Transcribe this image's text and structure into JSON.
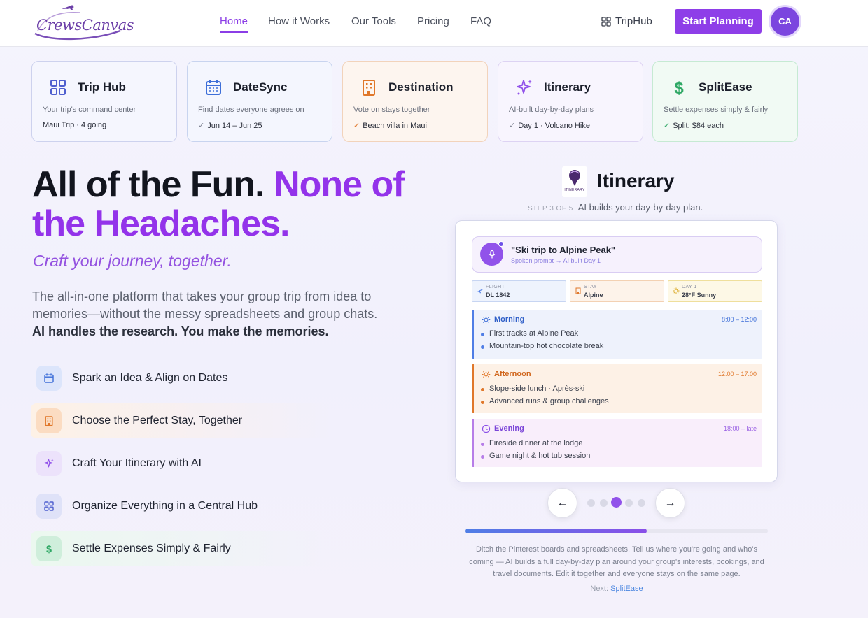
{
  "brand": {
    "name": "CrewsCanvas"
  },
  "nav": {
    "links": [
      "Home",
      "How it Works",
      "Our Tools",
      "Pricing",
      "FAQ"
    ],
    "triphub_label": "TripHub",
    "cta_label": "Start Planning",
    "avatar_initials": "CA"
  },
  "cards": [
    {
      "title": "Trip Hub",
      "subtitle": "Your trip's command center",
      "meta": "Maui Trip · 4 going",
      "icon": "grid-icon",
      "color": "#4f5fcf"
    },
    {
      "title": "DateSync",
      "subtitle": "Find dates everyone agrees on",
      "meta": "Jun 14 – Jun 25",
      "icon": "calendar-icon",
      "color": "#3e6fd8"
    },
    {
      "title": "Destination",
      "subtitle": "Vote on stays together",
      "meta": "Beach villa in Maui",
      "icon": "building-icon",
      "color": "#e0772a"
    },
    {
      "title": "Itinerary",
      "subtitle": "AI-built day-by-day plans",
      "meta": "Day 1 · Volcano Hike",
      "icon": "sparkle-icon",
      "color": "#9152ea"
    },
    {
      "title": "SplitEase",
      "subtitle": "Settle expenses simply & fairly",
      "meta": "Split: $84 each",
      "icon": "dollar-icon",
      "color": "#2fa865"
    }
  ],
  "hero": {
    "title_dark": "All of the Fun. ",
    "title_purple": "None of the Headaches.",
    "tagline": "Craft your journey, together.",
    "description": "The all-in-one platform that takes your group trip from idea to memories—without the messy spreadsheets and group chats.",
    "description_bold": "AI handles the research. You make the memories."
  },
  "steps": [
    {
      "label": "Spark an Idea & Align on Dates",
      "icon": "calendar-icon",
      "color": "#3e6fd8"
    },
    {
      "label": "Choose the Perfect Stay, Together",
      "icon": "building-icon",
      "color": "#e0772a"
    },
    {
      "label": "Craft Your Itinerary with AI",
      "icon": "sparkle-icon",
      "color": "#9152ea"
    },
    {
      "label": "Organize Everything in a Central Hub",
      "icon": "grid-icon",
      "color": "#4f5fcf"
    },
    {
      "label": "Settle Expenses Simply & Fairly",
      "icon": "dollar-icon",
      "color": "#2fa865"
    }
  ],
  "pane": {
    "title": "Itinerary",
    "step_count": "STEP 3 OF 5",
    "step_desc": "AI builds your day-by-day plan.",
    "logo_text": "ITINERARY"
  },
  "phone": {
    "prompt_text": "\"Ski trip to Alpine Peak\"",
    "prompt_sub": "Spoken prompt → AI built Day 1",
    "chips": [
      {
        "label": "FLIGHT",
        "value": "DL 1842",
        "icon": "plane-icon"
      },
      {
        "label": "STAY",
        "value": "Alpine",
        "icon": "building-icon"
      },
      {
        "label": "DAY 1",
        "value": "28°F Sunny",
        "icon": "sun-icon"
      }
    ],
    "slots": [
      {
        "title": "Morning",
        "time": "8:00 – 12:00",
        "items": [
          "First tracks at Alpine Peak",
          "Mountain-top hot chocolate break"
        ],
        "icon": "sun-icon"
      },
      {
        "title": "Afternoon",
        "time": "12:00 – 17:00",
        "items": [
          "Slope-side lunch · Après-ski",
          "Advanced runs & group challenges"
        ],
        "icon": "sun-icon"
      },
      {
        "title": "Evening",
        "time": "18:00 – late",
        "items": [
          "Fireside dinner at the lodge",
          "Game night & hot tub session"
        ],
        "icon": "clock-icon"
      }
    ]
  },
  "carousel": {
    "prev": "←",
    "next": "→",
    "active_index": 2,
    "total": 5,
    "progress": 0.6
  },
  "footer": {
    "explain": "Ditch the Pinterest boards and spreadsheets. Tell us where you're going and who's coming — AI builds a full day-by-day plan around your group's interests, bookings, and travel documents. Edit it together and everyone stays on the same page.",
    "next_prefix": "Next:",
    "next_link": "SplitEase"
  }
}
